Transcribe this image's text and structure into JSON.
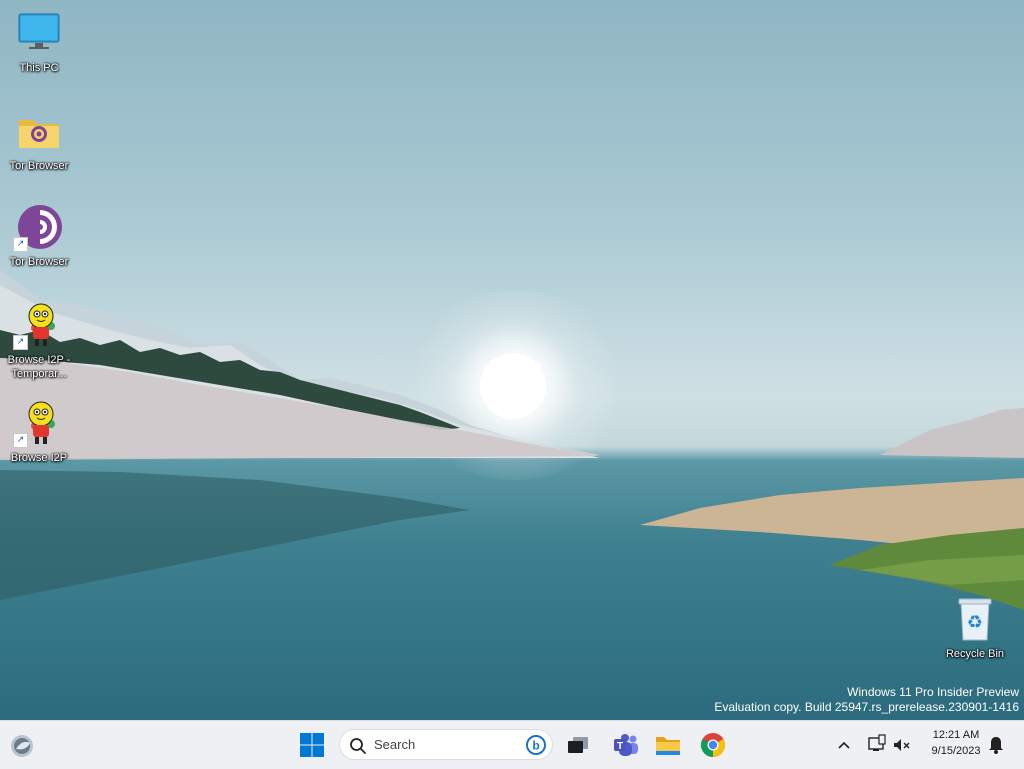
{
  "desktop_icons": [
    {
      "label": "This PC",
      "icon": "monitor-icon"
    },
    {
      "label": "Tor Browser",
      "icon": "tor-folder-icon"
    },
    {
      "label": "Tor Browser",
      "icon": "tor-browser-icon",
      "shortcut": true
    },
    {
      "label": "Browse I2P - Temporar...",
      "icon": "i2p-icon",
      "shortcut": true
    },
    {
      "label": "Browse I2P",
      "icon": "i2p-icon",
      "shortcut": true
    },
    {
      "label": "Recycle Bin",
      "icon": "recycle-bin-icon"
    }
  ],
  "watermark": {
    "line1": "Windows 11 Pro Insider Preview",
    "line2": "Evaluation copy. Build 25947.rs_prerelease.230901-1416"
  },
  "taskbar": {
    "search_placeholder": "Search",
    "apps": [
      "widgets-icon",
      "start-icon",
      "search-icon",
      "bing-icon",
      "task-view-icon",
      "teams-icon",
      "file-explorer-icon",
      "chrome-icon"
    ],
    "tray": {
      "time": "12:21 AM",
      "date": "9/15/2023"
    }
  },
  "colors": {
    "taskbar_bg": "#eef0f3",
    "accent_blue": "#0078d4",
    "tor_purple": "#7d4698"
  }
}
